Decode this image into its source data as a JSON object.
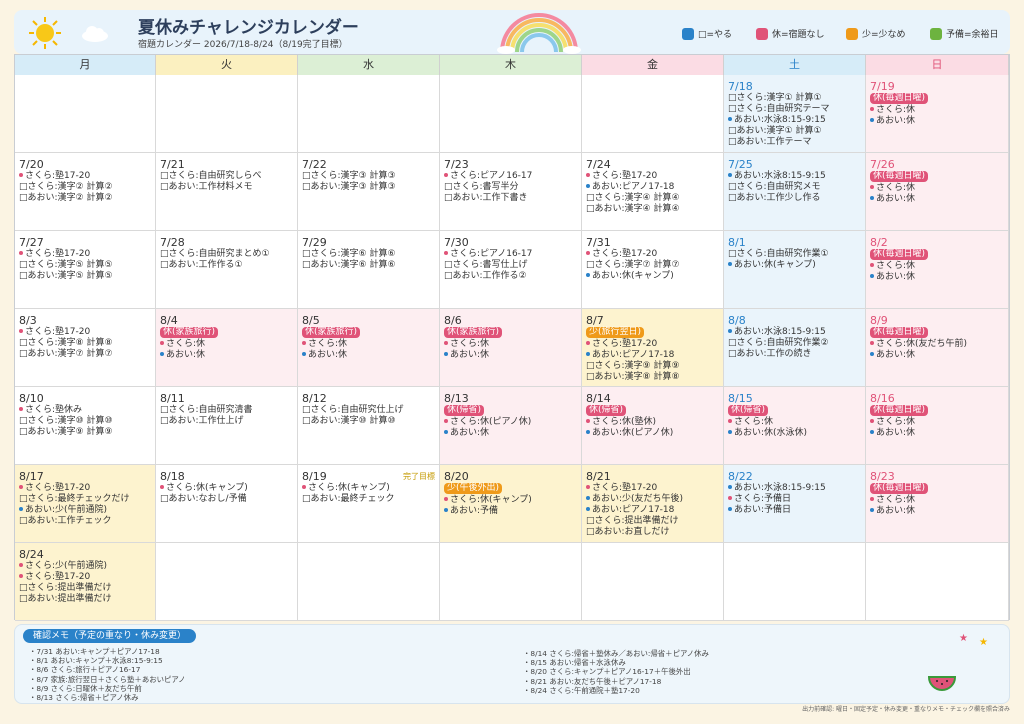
{
  "header": {
    "title": "夏休みチャレンジカレンダー",
    "subtitle": "宿題カレンダー 2026/7/18-8/24（8/19完了目標）"
  },
  "legend": [
    {
      "label": "□=やる",
      "color": "#2a82c9"
    },
    {
      "label": "休=宿題なし",
      "color": "#e05378"
    },
    {
      "label": "少=少なめ",
      "color": "#ef9a1a"
    },
    {
      "label": "予備=余裕日",
      "color": "#6db33f"
    }
  ],
  "days": [
    {
      "label": "月",
      "color": "#d6ecf8"
    },
    {
      "label": "火",
      "color": "#fbf0c0"
    },
    {
      "label": "水",
      "color": "#dcefd5"
    },
    {
      "label": "木",
      "color": "#dcefd5"
    },
    {
      "label": "金",
      "color": "#fbdce4"
    },
    {
      "label": "土",
      "color": "#d6ecf8"
    },
    {
      "label": "日",
      "color": "#fbdce4"
    }
  ],
  "colors": {
    "tag_red": "#e05378",
    "tag_orange": "#ef9a1a",
    "dot_pink": "#e05378",
    "dot_blue": "#2a82c9"
  },
  "weeks": [
    [
      null,
      null,
      null,
      null,
      null,
      {
        "date": "7/18",
        "bg": "#eaf4fb",
        "style": "blue",
        "lines": [
          {
            "k": "box",
            "t": "さくら:漢字① 計算①"
          },
          {
            "k": "box",
            "t": "さくら:自由研究テーマ"
          },
          {
            "k": "blue",
            "t": "あおい:水泳8:15-9:15"
          },
          {
            "k": "box",
            "t": "あおい:漢字① 計算①"
          },
          {
            "k": "box",
            "t": "あおい:工作テーマ"
          }
        ]
      },
      {
        "date": "7/19",
        "bg": "#fdeef1",
        "style": "red",
        "tag": {
          "t": "休(毎週日曜)",
          "c": "red"
        },
        "lines": [
          {
            "k": "pink",
            "t": "さくら:休"
          },
          {
            "k": "blue",
            "t": "あおい:休"
          }
        ]
      }
    ],
    [
      {
        "date": "7/20",
        "bg": "#ffffff",
        "lines": [
          {
            "k": "pink",
            "t": "さくら:塾17-20"
          },
          {
            "k": "box",
            "t": "さくら:漢字② 計算②"
          },
          {
            "k": "box",
            "t": "あおい:漢字② 計算②"
          }
        ]
      },
      {
        "date": "7/21",
        "bg": "#ffffff",
        "lines": [
          {
            "k": "box",
            "t": "さくら:自由研究しらべ"
          },
          {
            "k": "box",
            "t": "あおい:工作材料メモ"
          }
        ]
      },
      {
        "date": "7/22",
        "bg": "#ffffff",
        "lines": [
          {
            "k": "box",
            "t": "さくら:漢字③ 計算③"
          },
          {
            "k": "box",
            "t": "あおい:漢字③ 計算③"
          }
        ]
      },
      {
        "date": "7/23",
        "bg": "#ffffff",
        "lines": [
          {
            "k": "pink",
            "t": "さくら:ピアノ16-17"
          },
          {
            "k": "box",
            "t": "さくら:書写半分"
          },
          {
            "k": "box",
            "t": "あおい:工作下書き"
          }
        ]
      },
      {
        "date": "7/24",
        "bg": "#ffffff",
        "lines": [
          {
            "k": "pink",
            "t": "さくら:塾17-20"
          },
          {
            "k": "blue",
            "t": "あおい:ピアノ17-18"
          },
          {
            "k": "box",
            "t": "さくら:漢字④ 計算④"
          },
          {
            "k": "box",
            "t": "あおい:漢字④ 計算④"
          }
        ]
      },
      {
        "date": "7/25",
        "bg": "#eaf4fb",
        "style": "blue",
        "lines": [
          {
            "k": "blue",
            "t": "あおい:水泳8:15-9:15"
          },
          {
            "k": "box",
            "t": "さくら:自由研究メモ"
          },
          {
            "k": "box",
            "t": "あおい:工作少し作る"
          }
        ]
      },
      {
        "date": "7/26",
        "bg": "#fdeef1",
        "style": "red",
        "tag": {
          "t": "休(毎週日曜)",
          "c": "red"
        },
        "lines": [
          {
            "k": "pink",
            "t": "さくら:休"
          },
          {
            "k": "blue",
            "t": "あおい:休"
          }
        ]
      }
    ],
    [
      {
        "date": "7/27",
        "bg": "#ffffff",
        "lines": [
          {
            "k": "pink",
            "t": "さくら:塾17-20"
          },
          {
            "k": "box",
            "t": "さくら:漢字⑤ 計算⑤"
          },
          {
            "k": "box",
            "t": "あおい:漢字⑤ 計算⑤"
          }
        ]
      },
      {
        "date": "7/28",
        "bg": "#ffffff",
        "lines": [
          {
            "k": "box",
            "t": "さくら:自由研究まとめ①"
          },
          {
            "k": "box",
            "t": "あおい:工作作る①"
          }
        ]
      },
      {
        "date": "7/29",
        "bg": "#ffffff",
        "lines": [
          {
            "k": "box",
            "t": "さくら:漢字⑥ 計算⑥"
          },
          {
            "k": "box",
            "t": "あおい:漢字⑥ 計算⑥"
          }
        ]
      },
      {
        "date": "7/30",
        "bg": "#ffffff",
        "lines": [
          {
            "k": "pink",
            "t": "さくら:ピアノ16-17"
          },
          {
            "k": "box",
            "t": "さくら:書写仕上げ"
          },
          {
            "k": "box",
            "t": "あおい:工作作る②"
          }
        ]
      },
      {
        "date": "7/31",
        "bg": "#ffffff",
        "lines": [
          {
            "k": "pink",
            "t": "さくら:塾17-20"
          },
          {
            "k": "box",
            "t": "さくら:漢字⑦ 計算⑦"
          },
          {
            "k": "blue",
            "t": "あおい:休(キャンプ)"
          }
        ]
      },
      {
        "date": "8/1",
        "bg": "#eaf4fb",
        "style": "blue",
        "lines": [
          {
            "k": "box",
            "t": "さくら:自由研究作業①"
          },
          {
            "k": "blue",
            "t": "あおい:休(キャンプ)"
          }
        ]
      },
      {
        "date": "8/2",
        "bg": "#fdeef1",
        "style": "red",
        "tag": {
          "t": "休(毎週日曜)",
          "c": "red"
        },
        "lines": [
          {
            "k": "pink",
            "t": "さくら:休"
          },
          {
            "k": "blue",
            "t": "あおい:休"
          }
        ]
      }
    ],
    [
      {
        "date": "8/3",
        "bg": "#ffffff",
        "lines": [
          {
            "k": "pink",
            "t": "さくら:塾17-20"
          },
          {
            "k": "box",
            "t": "さくら:漢字⑧ 計算⑧"
          },
          {
            "k": "box",
            "t": "あおい:漢字⑦ 計算⑦"
          }
        ]
      },
      {
        "date": "8/4",
        "bg": "#fdeef1",
        "tag": {
          "t": "休(家族旅行)",
          "c": "red"
        },
        "lines": [
          {
            "k": "pink",
            "t": "さくら:休"
          },
          {
            "k": "blue",
            "t": "あおい:休"
          }
        ]
      },
      {
        "date": "8/5",
        "bg": "#fdeef1",
        "tag": {
          "t": "休(家族旅行)",
          "c": "red"
        },
        "lines": [
          {
            "k": "pink",
            "t": "さくら:休"
          },
          {
            "k": "blue",
            "t": "あおい:休"
          }
        ]
      },
      {
        "date": "8/6",
        "bg": "#fdeef1",
        "tag": {
          "t": "休(家族旅行)",
          "c": "red"
        },
        "lines": [
          {
            "k": "pink",
            "t": "さくら:休"
          },
          {
            "k": "blue",
            "t": "あおい:休"
          }
        ]
      },
      {
        "date": "8/7",
        "bg": "#fdf3cf",
        "tag": {
          "t": "少(旅行翌日)",
          "c": "orange"
        },
        "lines": [
          {
            "k": "pink",
            "t": "さくら:塾17-20"
          },
          {
            "k": "blue",
            "t": "あおい:ピアノ17-18"
          },
          {
            "k": "box",
            "t": "さくら:漢字⑨ 計算⑨"
          },
          {
            "k": "box",
            "t": "あおい:漢字⑧ 計算⑧"
          }
        ]
      },
      {
        "date": "8/8",
        "bg": "#eaf4fb",
        "style": "blue",
        "lines": [
          {
            "k": "blue",
            "t": "あおい:水泳8:15-9:15"
          },
          {
            "k": "box",
            "t": "さくら:自由研究作業②"
          },
          {
            "k": "box",
            "t": "あおい:工作の続き"
          }
        ]
      },
      {
        "date": "8/9",
        "bg": "#fdeef1",
        "style": "red",
        "tag": {
          "t": "休(毎週日曜)",
          "c": "red"
        },
        "lines": [
          {
            "k": "pink",
            "t": "さくら:休(友だち午前)"
          },
          {
            "k": "blue",
            "t": "あおい:休"
          }
        ]
      }
    ],
    [
      {
        "date": "8/10",
        "bg": "#ffffff",
        "lines": [
          {
            "k": "pink",
            "t": "さくら:塾休み"
          },
          {
            "k": "box",
            "t": "さくら:漢字⑩ 計算⑩"
          },
          {
            "k": "box",
            "t": "あおい:漢字⑨ 計算⑨"
          }
        ]
      },
      {
        "date": "8/11",
        "bg": "#ffffff",
        "lines": [
          {
            "k": "box",
            "t": "さくら:自由研究清書"
          },
          {
            "k": "box",
            "t": "あおい:工作仕上げ"
          }
        ]
      },
      {
        "date": "8/12",
        "bg": "#ffffff",
        "lines": [
          {
            "k": "box",
            "t": "さくら:自由研究仕上げ"
          },
          {
            "k": "box",
            "t": "あおい:漢字⑩ 計算⑩"
          }
        ]
      },
      {
        "date": "8/13",
        "bg": "#fdeef1",
        "tag": {
          "t": "休(帰省)",
          "c": "red"
        },
        "lines": [
          {
            "k": "pink",
            "t": "さくら:休(ピアノ休)"
          },
          {
            "k": "blue",
            "t": "あおい:休"
          }
        ]
      },
      {
        "date": "8/14",
        "bg": "#fdeef1",
        "tag": {
          "t": "休(帰省)",
          "c": "red"
        },
        "lines": [
          {
            "k": "pink",
            "t": "さくら:休(塾休)"
          },
          {
            "k": "blue",
            "t": "あおい:休(ピアノ休)"
          }
        ]
      },
      {
        "date": "8/15",
        "bg": "#fdeef1",
        "style": "blue",
        "tag": {
          "t": "休(帰省)",
          "c": "red"
        },
        "lines": [
          {
            "k": "pink",
            "t": "さくら:休"
          },
          {
            "k": "blue",
            "t": "あおい:休(水泳休)"
          }
        ]
      },
      {
        "date": "8/16",
        "bg": "#fdeef1",
        "style": "red",
        "tag": {
          "t": "休(毎週日曜)",
          "c": "red"
        },
        "lines": [
          {
            "k": "pink",
            "t": "さくら:休"
          },
          {
            "k": "blue",
            "t": "あおい:休"
          }
        ]
      }
    ],
    [
      {
        "date": "8/17",
        "bg": "#fdf3cf",
        "lines": [
          {
            "k": "pink",
            "t": "さくら:塾17-20"
          },
          {
            "k": "box",
            "t": "さくら:最終チェックだけ"
          },
          {
            "k": "blue",
            "t": "あおい:少(午前通院)"
          },
          {
            "k": "box",
            "t": "あおい:工作チェック"
          }
        ]
      },
      {
        "date": "8/18",
        "bg": "#ffffff",
        "lines": [
          {
            "k": "pink",
            "t": "さくら:休(キャンプ)"
          },
          {
            "k": "box",
            "t": "あおい:なおし/予備"
          }
        ]
      },
      {
        "date": "8/19",
        "bg": "#ffffff",
        "goal": "完了目標",
        "lines": [
          {
            "k": "pink",
            "t": "さくら:休(キャンプ)"
          },
          {
            "k": "box",
            "t": "あおい:最終チェック"
          }
        ]
      },
      {
        "date": "8/20",
        "bg": "#fdf3cf",
        "tag": {
          "t": "少(午後外出)",
          "c": "orange"
        },
        "lines": [
          {
            "k": "pink",
            "t": "さくら:休(キャンプ)"
          },
          {
            "k": "blue",
            "t": "あおい:予備"
          }
        ]
      },
      {
        "date": "8/21",
        "bg": "#fdf3cf",
        "lines": [
          {
            "k": "pink",
            "t": "さくら:塾17-20"
          },
          {
            "k": "blue",
            "t": "あおい:少(友だち午後)"
          },
          {
            "k": "blue",
            "t": "あおい:ピアノ17-18"
          },
          {
            "k": "box",
            "t": "さくら:提出準備だけ"
          },
          {
            "k": "box",
            "t": "あおい:お直しだけ"
          }
        ]
      },
      {
        "date": "8/22",
        "bg": "#eaf4fb",
        "style": "blue",
        "lines": [
          {
            "k": "blue",
            "t": "あおい:水泳8:15-9:15"
          },
          {
            "k": "pink",
            "t": "さくら:予備日"
          },
          {
            "k": "blue",
            "t": "あおい:予備日"
          }
        ]
      },
      {
        "date": "8/23",
        "bg": "#fdeef1",
        "style": "red",
        "tag": {
          "t": "休(毎週日曜)",
          "c": "red"
        },
        "lines": [
          {
            "k": "pink",
            "t": "さくら:休"
          },
          {
            "k": "blue",
            "t": "あおい:休"
          }
        ]
      }
    ],
    [
      {
        "date": "8/24",
        "bg": "#fdf3cf",
        "lines": [
          {
            "k": "pink",
            "t": "さくら:少(午前通院)"
          },
          {
            "k": "pink",
            "t": "さくら:塾17-20"
          },
          {
            "k": "box",
            "t": "さくら:提出準備だけ"
          },
          {
            "k": "box",
            "t": "あおい:提出準備だけ"
          }
        ]
      },
      null,
      null,
      null,
      null,
      null,
      null
    ]
  ],
  "memo": {
    "title": "確認メモ（予定の重なり・休み変更）",
    "left": [
      "・7/31 あおい:キャンプ＋ピアノ17-18",
      "・8/1 あおい:キャンプ＋水泳8:15-9:15",
      "・8/6 さくら:旅行＋ピアノ16-17",
      "・8/7 家族:旅行翌日＋さくら塾＋あおいピアノ",
      "・8/9 さくら:日曜休＋友だち午前",
      "・8/13 さくら:帰省＋ピアノ休み"
    ],
    "right": [
      "・8/14 さくら:帰省＋塾休み／あおい:帰省＋ピアノ休み",
      "・8/15 あおい:帰省＋水泳休み",
      "・8/20 さくら:キャンプ＋ピアノ16-17＋午後外出",
      "・8/21 あおい:友だち午後＋ピアノ17-18",
      "・8/24 さくら:午前通院＋塾17-20"
    ]
  },
  "footer": "出力前確認: 曜日・固定予定・休み変更・重なりメモ・チェック欄を照合済み"
}
